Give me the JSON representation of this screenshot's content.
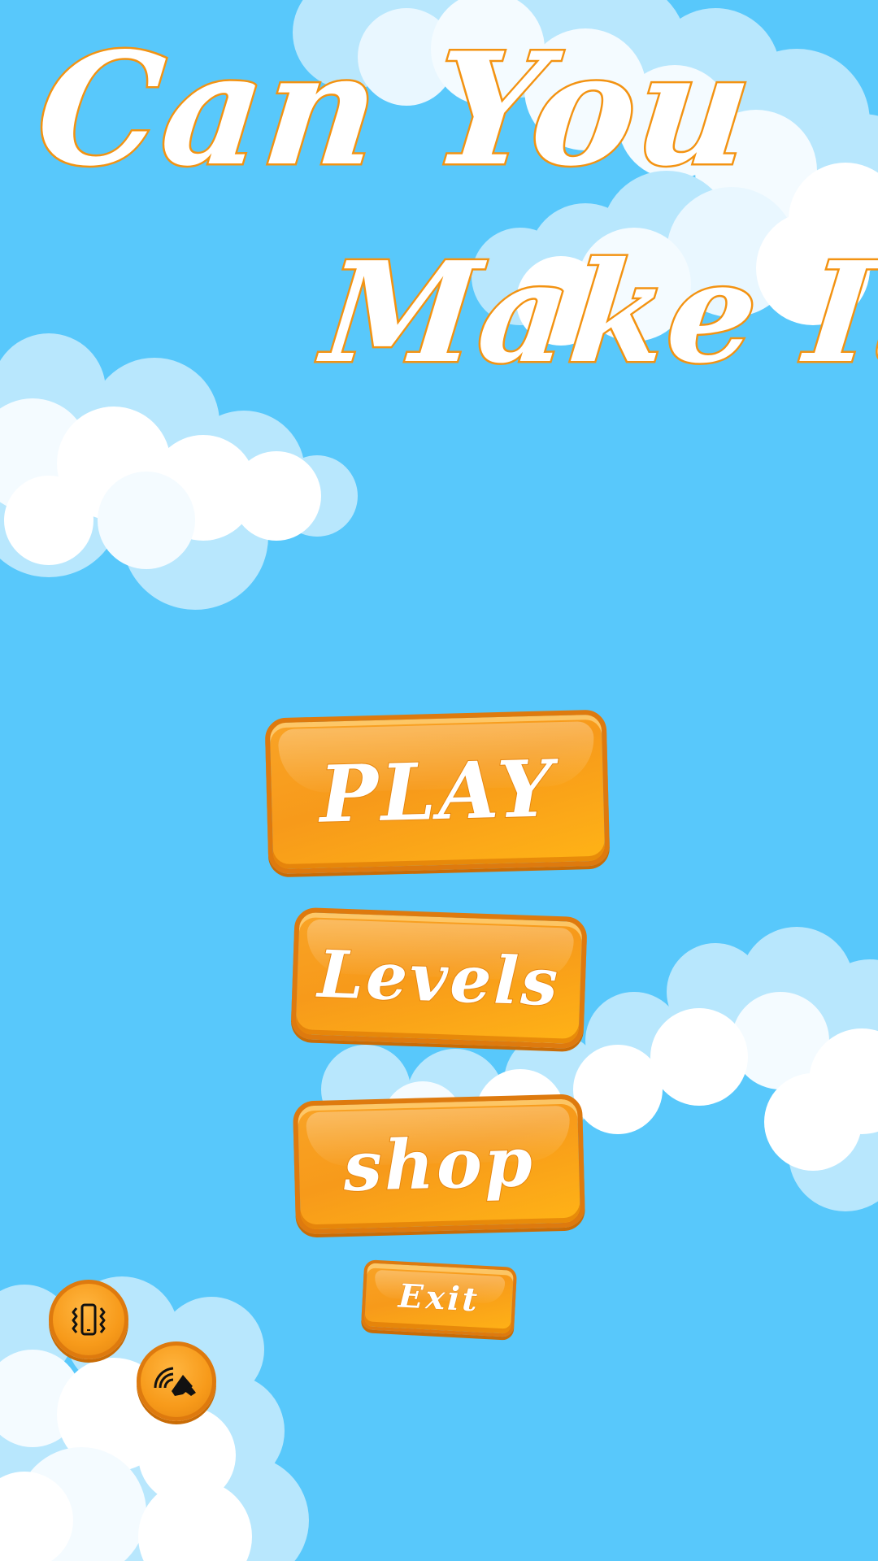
{
  "game": {
    "title_line1": "Can You",
    "title_line2": "Make It ?"
  },
  "menu": {
    "play_label": "PLAY",
    "levels_label": "Levels",
    "shop_label": "shop",
    "exit_label": "Exit"
  },
  "settings": {
    "vibrate_icon": "vibrate-phone-icon",
    "sound_icon": "speaker-sound-icon"
  },
  "colors": {
    "sky": "#58c8fb",
    "button_orange": "#f79a1a",
    "button_border": "#de7a0e",
    "title_outline": "#f39312",
    "text": "#ffffff"
  }
}
